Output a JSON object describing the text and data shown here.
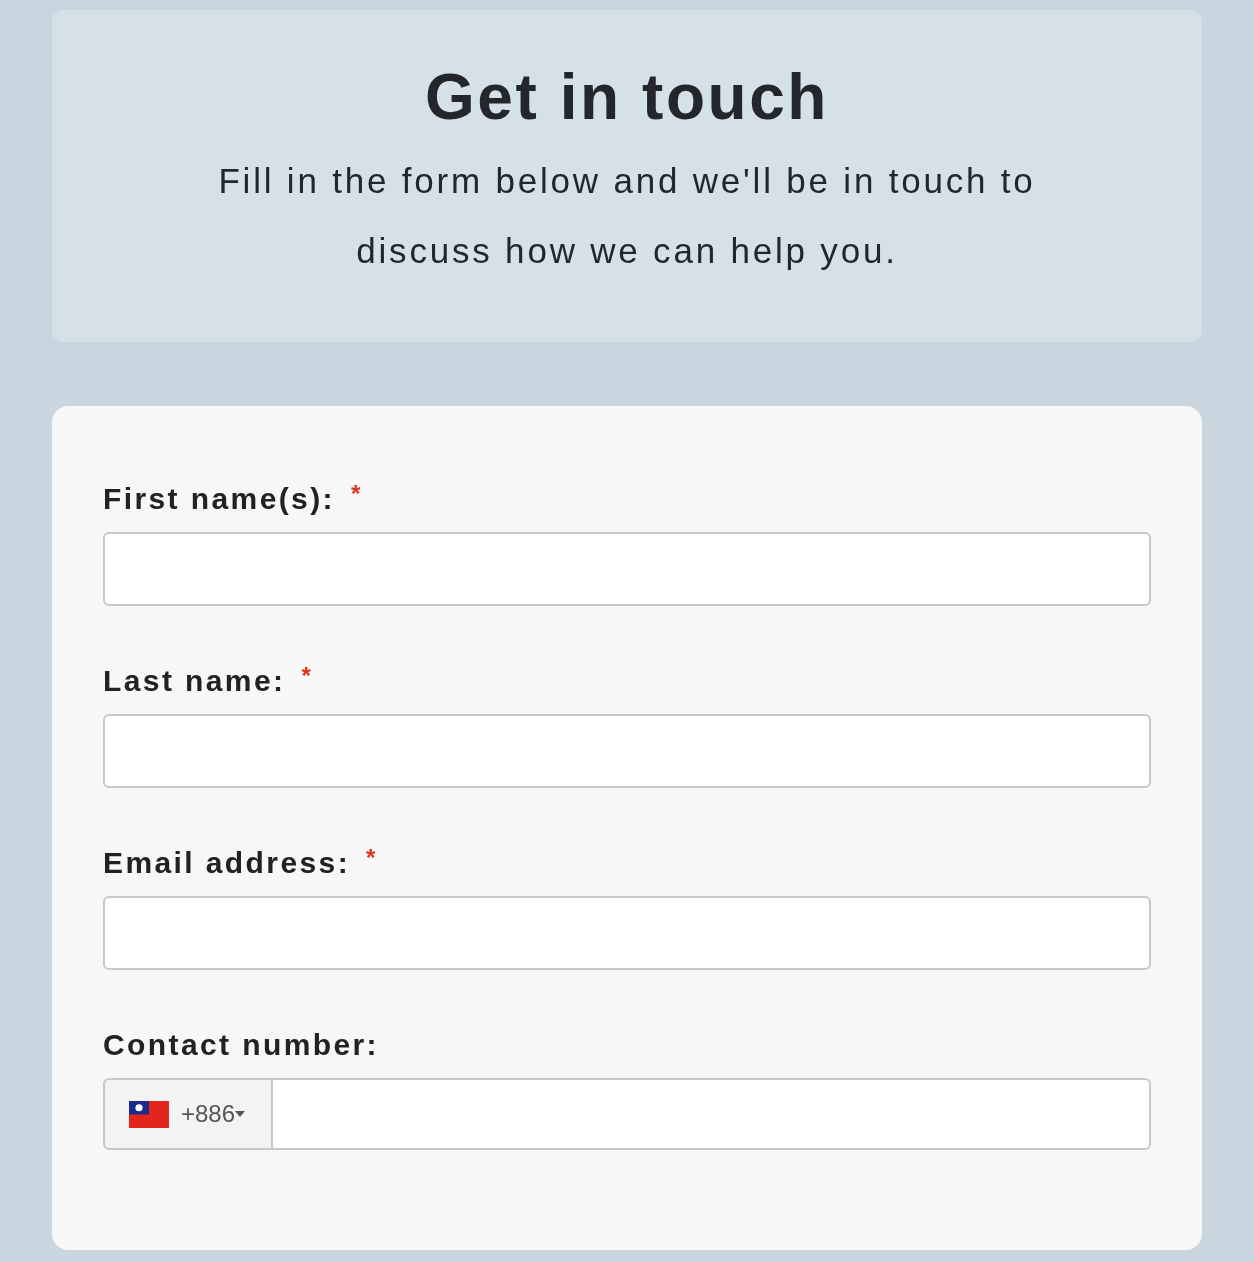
{
  "header": {
    "title": "Get in touch",
    "subtitle": "Fill in the form below and we'll be in touch to discuss how we can help you."
  },
  "fields": [
    {
      "kind": "text",
      "label": "First name(s):",
      "required_mark": "*"
    },
    {
      "kind": "text",
      "label": "Last name:",
      "required_mark": "*"
    },
    {
      "kind": "text",
      "label": "Email address:",
      "required_mark": "*"
    },
    {
      "kind": "phone",
      "label": "Contact number:",
      "dial_code": "+886"
    }
  ]
}
